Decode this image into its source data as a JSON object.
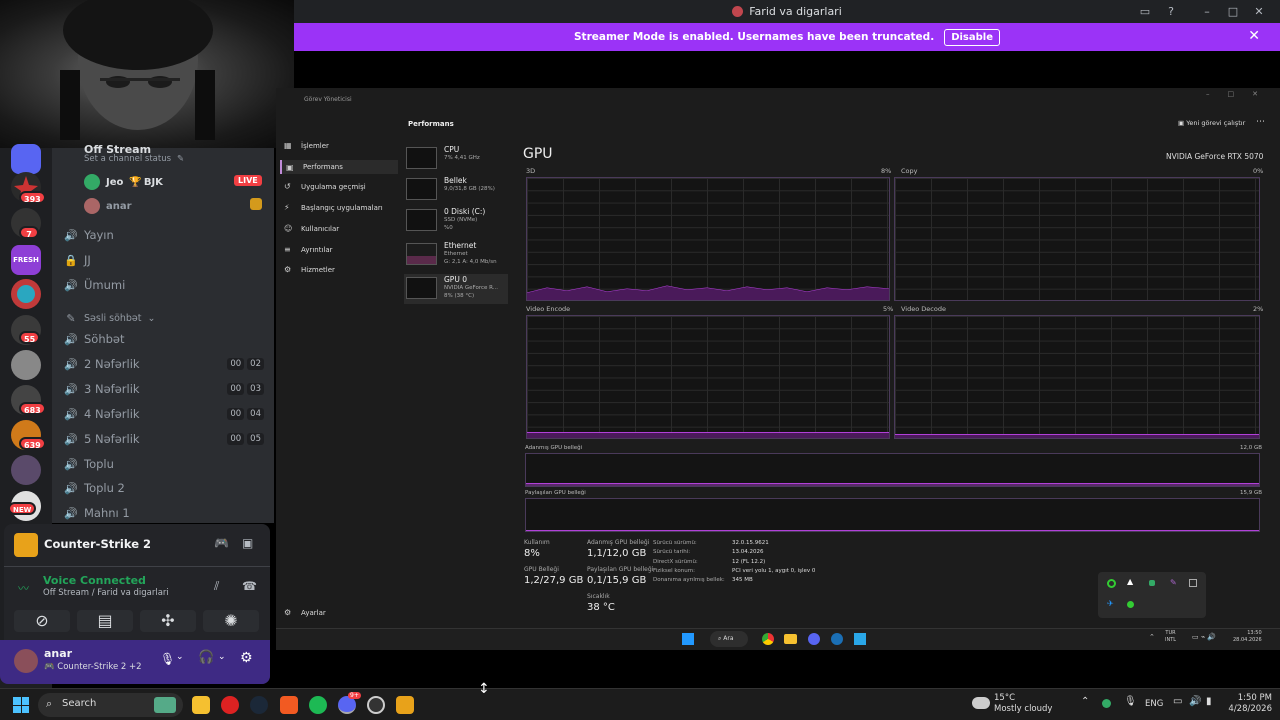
{
  "window": {
    "title": "Farid va digarlari"
  },
  "banner": {
    "text": "Streamer Mode is enabled. Usernames have been truncated.",
    "button": "Disable"
  },
  "sidebar": {
    "badges": [
      "393",
      "7",
      "55",
      "683",
      "639",
      "NEW"
    ],
    "server_fresh": "FRESH",
    "channel_status": "Set a channel status",
    "stream_partial": "Off Stream",
    "members": [
      {
        "name": "Jeo",
        "tag": "BJK",
        "live": "LIVE"
      },
      {
        "name": "anar"
      }
    ],
    "channels_top": [
      "Yayın",
      "JJ",
      "Ümumi"
    ],
    "category": "Səsli söhbət",
    "channels": [
      {
        "name": "Söhbət"
      },
      {
        "name": "2 Nəfərlik",
        "a": "00",
        "b": "02"
      },
      {
        "name": "3 Nəfərlik",
        "a": "00",
        "b": "03"
      },
      {
        "name": "4 Nəfərlik",
        "a": "00",
        "b": "04"
      },
      {
        "name": "5 Nəfərlik",
        "a": "00",
        "b": "05"
      },
      {
        "name": "Toplu"
      },
      {
        "name": "Toplu 2"
      },
      {
        "name": "Mahnı 1"
      }
    ]
  },
  "voice_panel": {
    "game": "Counter-Strike 2",
    "status": "Voice Connected",
    "sub": "Off Stream / Farid va digarlari",
    "user": "anar",
    "user_activity": "Counter-Strike 2 +2"
  },
  "taskmgr": {
    "title": "Görev Yöneticisi",
    "section": "Performans",
    "run_task": "Yeni görevi çalıştır",
    "nav": [
      "İşlemler",
      "Performans",
      "Uygulama geçmişi",
      "Başlangıç uygulamaları",
      "Kullanıcılar",
      "Ayrıntılar",
      "Hizmetler"
    ],
    "settings": "Ayarlar",
    "perf_items": [
      {
        "name": "CPU",
        "sub": "7% 4,41 GHz"
      },
      {
        "name": "Bellek",
        "sub": "9,0/31,8 GB (28%)"
      },
      {
        "name": "0 Diski (C:)",
        "sub": "SSD (NVMe)\n%0"
      },
      {
        "name": "Ethernet",
        "sub": "Ethernet\nG: 2,1 A: 4,0 Mb/sn"
      },
      {
        "name": "GPU 0",
        "sub": "NVIDIA GeForce R...\n8% (38 °C)"
      }
    ],
    "gpu_title": "GPU",
    "gpu_name": "NVIDIA GeForce RTX 5070",
    "graphs": [
      {
        "label": "3D",
        "pct": "8%"
      },
      {
        "label": "Copy",
        "pct": "0%"
      },
      {
        "label": "Video Encode",
        "pct": "5%"
      },
      {
        "label": "Video Decode",
        "pct": "2%"
      }
    ],
    "dedicated_label": "Adanmış GPU belleği",
    "dedicated_max": "12,0 GB",
    "shared_label": "Paylaşılan GPU belleği",
    "shared_max": "15,9 GB",
    "stats": {
      "usage_label": "Kullanım",
      "usage": "8%",
      "gpu_mem_label": "GPU Belleği",
      "gpu_mem": "1,2/27,9 GB",
      "ded_label": "Adanmış GPU belleği",
      "ded": "1,1/12,0 GB",
      "shared_label": "Paylaşılan GPU belleği",
      "shared": "0,1/15,9 GB",
      "temp_label": "Sıcaklık",
      "temp": "38 °C"
    },
    "details": [
      {
        "k": "Sürücü sürümü:",
        "v": "32.0.15.9621"
      },
      {
        "k": "Sürücü tarihi:",
        "v": "13.04.2026"
      },
      {
        "k": "DirectX sürümü:",
        "v": "12 (FL 12.2)"
      },
      {
        "k": "Fiziksel konum:",
        "v": "PCI veri yolu 1, aygıt 0, işlev 0"
      },
      {
        "k": "Donanıma ayrılmış bellek:",
        "v": "345 MB"
      }
    ],
    "inner_taskbar": {
      "search": "Ara",
      "lang1": "TUR",
      "lang2": "INTL",
      "time": "13:50",
      "date": "28.04.2026"
    }
  },
  "taskbar": {
    "search": "Search",
    "weather_temp": "15°C",
    "weather_desc": "Mostly cloudy",
    "lang": "ENG",
    "time": "1:50 PM",
    "date": "4/28/2026",
    "discord_badge": "9+"
  },
  "colors": {
    "banner": "#9b33f7",
    "gpu_line": "#b140d8",
    "voice_green": "#23a55a",
    "badge_red": "#f23f43"
  }
}
